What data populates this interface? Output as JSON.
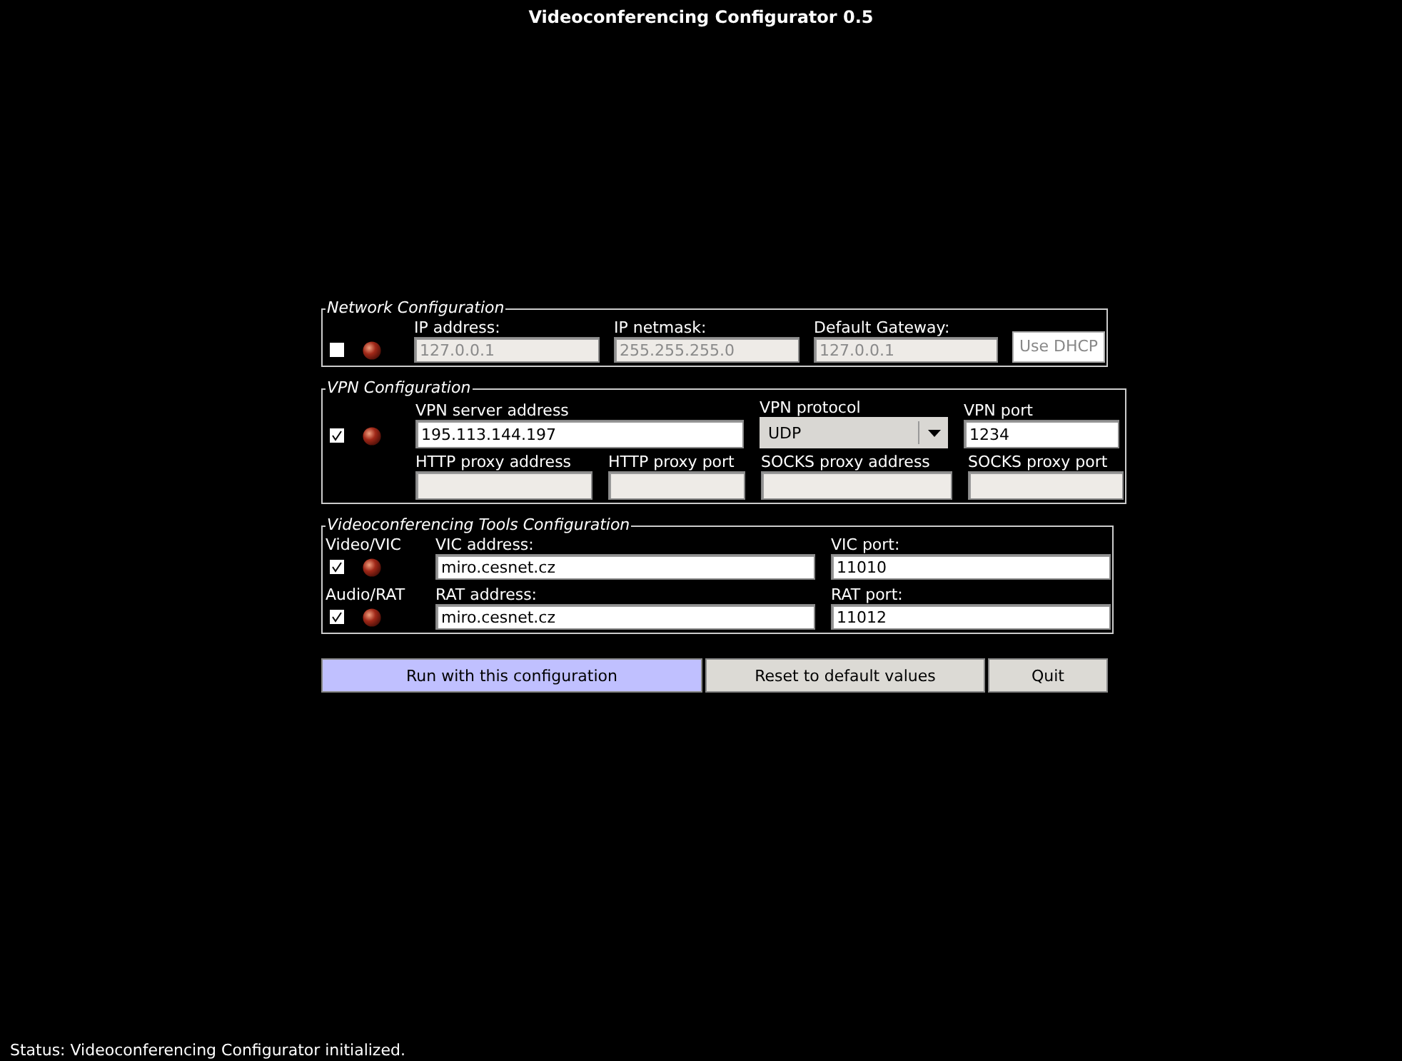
{
  "window": {
    "title": "Videoconferencing Configurator 0.5"
  },
  "network": {
    "legend": "Network Configuration",
    "checked": false,
    "fields": [
      {
        "label": "IP address:",
        "value": "127.0.0.1",
        "disabled": true
      },
      {
        "label": "IP netmask:",
        "value": "255.255.255.0",
        "disabled": true
      },
      {
        "label": "Default Gateway:",
        "value": "127.0.0.1",
        "disabled": true
      }
    ],
    "dhcp_button": {
      "label": "Use DHCP",
      "disabled": true
    }
  },
  "vpn": {
    "legend": "VPN Configuration",
    "checked": true,
    "server": {
      "label": "VPN server address",
      "value": "195.113.144.197",
      "disabled": false
    },
    "protocol": {
      "label": "VPN protocol",
      "value": "UDP"
    },
    "port": {
      "label": "VPN port",
      "value": "1234",
      "disabled": false
    },
    "proxies": [
      {
        "label": "HTTP proxy address",
        "disabled": true
      },
      {
        "label": "HTTP proxy port",
        "disabled": true
      },
      {
        "label": "SOCKS proxy address",
        "disabled": true
      },
      {
        "label": "SOCKS proxy port",
        "disabled": true
      }
    ]
  },
  "tools": {
    "legend": "Videoconferencing Tools Configuration",
    "rows": [
      {
        "name": "Video/VIC",
        "checked": true,
        "address_label": "VIC address:",
        "address": "miro.cesnet.cz",
        "port_label": "VIC port:",
        "port": "11010"
      },
      {
        "name": "Audio/RAT",
        "checked": true,
        "address_label": "RAT address:",
        "address": "miro.cesnet.cz",
        "port_label": "RAT port:",
        "port": "11012"
      }
    ]
  },
  "buttons": [
    {
      "label": "Run with this configuration",
      "highlighted": true
    },
    {
      "label": "Reset to default values",
      "highlighted": false
    },
    {
      "label": "Quit",
      "highlighted": false
    }
  ],
  "status_bar": "Status: Videoconferencing Configurator initialized."
}
